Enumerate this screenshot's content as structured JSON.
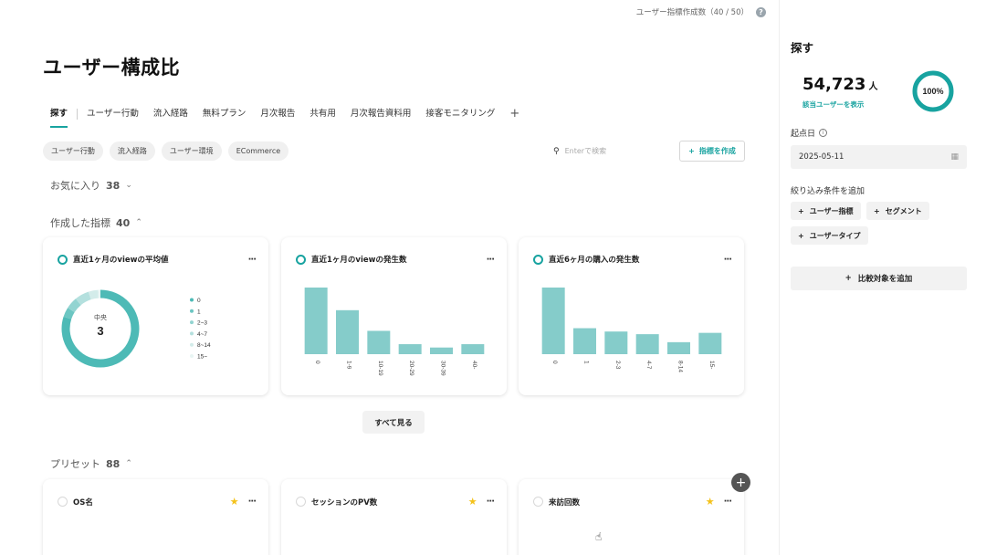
{
  "topbar": {
    "quota": "ユーザー指標作成数（40 / 50）",
    "help_icon": "?"
  },
  "page_title": "ユーザー構成比",
  "tabs": [
    "探す",
    "ユーザー行動",
    "流入経路",
    "無料プラン",
    "月次報告",
    "共有用",
    "月次報告資料用",
    "接客モニタリング"
  ],
  "tab_add": "+",
  "chips": [
    "ユーザー行動",
    "流入経路",
    "ユーザー環境",
    "ECommerce"
  ],
  "search": {
    "placeholder": "Enterで検索"
  },
  "create_button": "指標を作成",
  "sections": {
    "favorites": {
      "label": "お気に入り",
      "count": "38"
    },
    "created": {
      "label": "作成した指標",
      "count": "40"
    },
    "preset": {
      "label": "プリセット",
      "count": "88"
    }
  },
  "cards": [
    {
      "title": "直近1ヶ月のviewの平均値",
      "center_label": "中央",
      "center_value": "3",
      "legend": [
        "0",
        "1",
        "2~3",
        "4~7",
        "8~14",
        "15~"
      ]
    },
    {
      "title": "直近1ヶ月のviewの発生数",
      "categories": [
        "0",
        "1-9",
        "10-19",
        "20-29",
        "30-39",
        "40-"
      ]
    },
    {
      "title": "直近6ヶ月の購入の発生数",
      "categories": [
        "0",
        "1",
        "2-3",
        "4-7",
        "8-14",
        "15-"
      ]
    }
  ],
  "see_all": "すべて見る",
  "preset_cards": [
    "OS名",
    "セッションのPV数",
    "来訪回数"
  ],
  "more_label": "···",
  "fab": "+",
  "right": {
    "title": "探す",
    "users": "54,723",
    "unit": "人",
    "link": "該当ユーザーを表示",
    "percent": "100%",
    "start_date_label": "起点日",
    "start_date": "2025-05-11",
    "filter_label": "絞り込み条件を追加",
    "filters": [
      "ユーザー指標",
      "セグメント",
      "ユーザータイプ"
    ],
    "compare": "比較対象を追加"
  },
  "colors": {
    "accent": "#18a3a0",
    "bar": "#7ec9c7",
    "star": "#f4c21b"
  },
  "chart_data": [
    {
      "type": "pie",
      "title": "直近1ヶ月のviewの平均値",
      "categories": [
        "0",
        "1",
        "2~3",
        "4~7",
        "8~14",
        "15~"
      ],
      "values": [
        80,
        4,
        5,
        6,
        4,
        1
      ]
    },
    {
      "type": "bar",
      "title": "直近1ヶ月のviewの発生数",
      "categories": [
        "0",
        "1-9",
        "10-19",
        "20-29",
        "30-39",
        "40-"
      ],
      "values": [
        100,
        66,
        35,
        15,
        10,
        15
      ],
      "ylim": [
        0,
        100
      ]
    },
    {
      "type": "bar",
      "title": "直近6ヶ月の購入の発生数",
      "categories": [
        "0",
        "1",
        "2-3",
        "4-7",
        "8-14",
        "15-"
      ],
      "values": [
        100,
        39,
        34,
        30,
        18,
        32
      ],
      "ylim": [
        0,
        100
      ]
    }
  ]
}
